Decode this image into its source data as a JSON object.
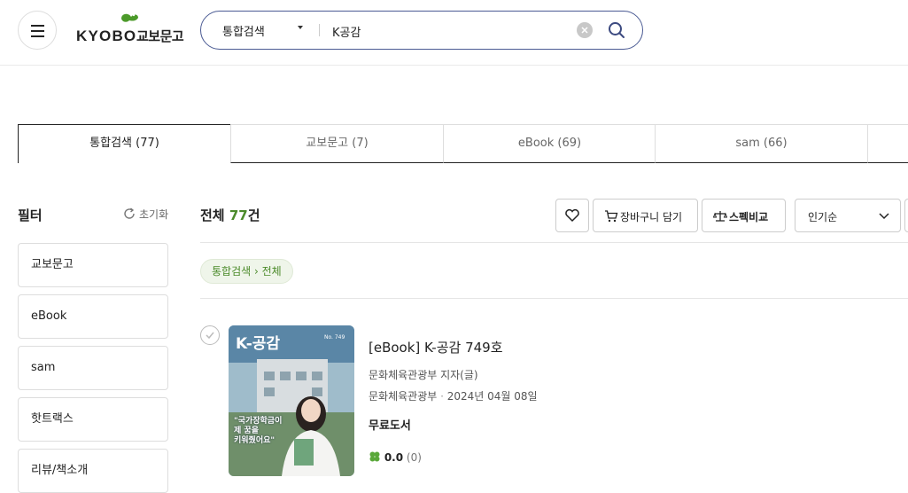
{
  "header": {
    "logo_en": "KYOBO",
    "logo_ko": "교보문고",
    "search": {
      "category": "통합검색",
      "query": "K공감"
    }
  },
  "tabs": [
    {
      "label": "통합검색 (77)",
      "active": true
    },
    {
      "label": "교보문고 (7)",
      "active": false
    },
    {
      "label": "eBook (69)",
      "active": false
    },
    {
      "label": "sam (66)",
      "active": false
    }
  ],
  "filter": {
    "title": "필터",
    "reset_label": "초기화",
    "items": [
      "교보문고",
      "eBook",
      "sam",
      "핫트랙스",
      "리뷰/책소개"
    ]
  },
  "results": {
    "total_prefix": "전체 ",
    "total_count": "77",
    "total_suffix": "건",
    "cart_label": "장바구니 담기",
    "compare_label": "스펙비교",
    "sort_label": "인기순",
    "breadcrumb": "통합검색 › 전체"
  },
  "book": {
    "cover_title": "K-공감",
    "cover_issue": "No. 749",
    "cover_quote": "\"국가장학금이\n제 꿈을\n키워줬어요\"",
    "title": "[eBook] K-공감 749호",
    "author": "문화체육관광부 지자(글)",
    "publisher": "문화체육관광부",
    "date": "2024년 04월 08일",
    "price": "무료도서",
    "rating": "0.0",
    "review_count": "(0)"
  },
  "colors": {
    "accent_green": "#4c8b2b",
    "search_border": "#4a5a93"
  }
}
